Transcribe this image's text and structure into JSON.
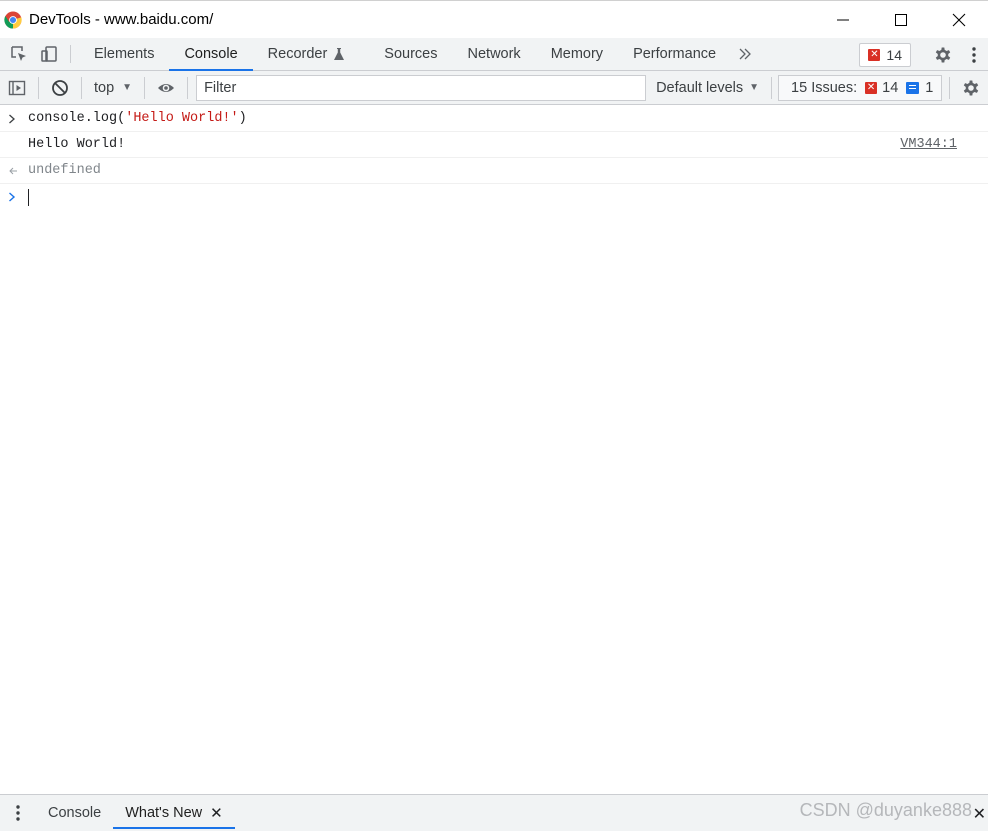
{
  "window": {
    "title": "DevTools - www.baidu.com/"
  },
  "tabs": {
    "items": [
      {
        "label": "Elements"
      },
      {
        "label": "Console"
      },
      {
        "label": "Recorder"
      },
      {
        "label": "Sources"
      },
      {
        "label": "Network"
      },
      {
        "label": "Memory"
      },
      {
        "label": "Performance"
      }
    ],
    "active": "Console",
    "error_count": "14"
  },
  "toolbar": {
    "context": "top",
    "filter_placeholder": "Filter",
    "levels": "Default levels",
    "issues_label": "15 Issues:",
    "issues_errors": "14",
    "issues_info": "1"
  },
  "console": {
    "input_code_prefix": "console.log(",
    "input_string": "'Hello World!'",
    "input_code_suffix": ")",
    "log_output": "Hello World!",
    "log_source": "VM344:1",
    "return_value": "undefined"
  },
  "drawer": {
    "tabs": [
      {
        "label": "Console"
      },
      {
        "label": "What's New"
      }
    ],
    "active": "What's New"
  },
  "watermark": "CSDN @duyanke888",
  "colors": {
    "accent": "#1a73e8",
    "error": "#d93025",
    "string": "#c41a16",
    "toolbar_bg": "#f1f3f4"
  }
}
